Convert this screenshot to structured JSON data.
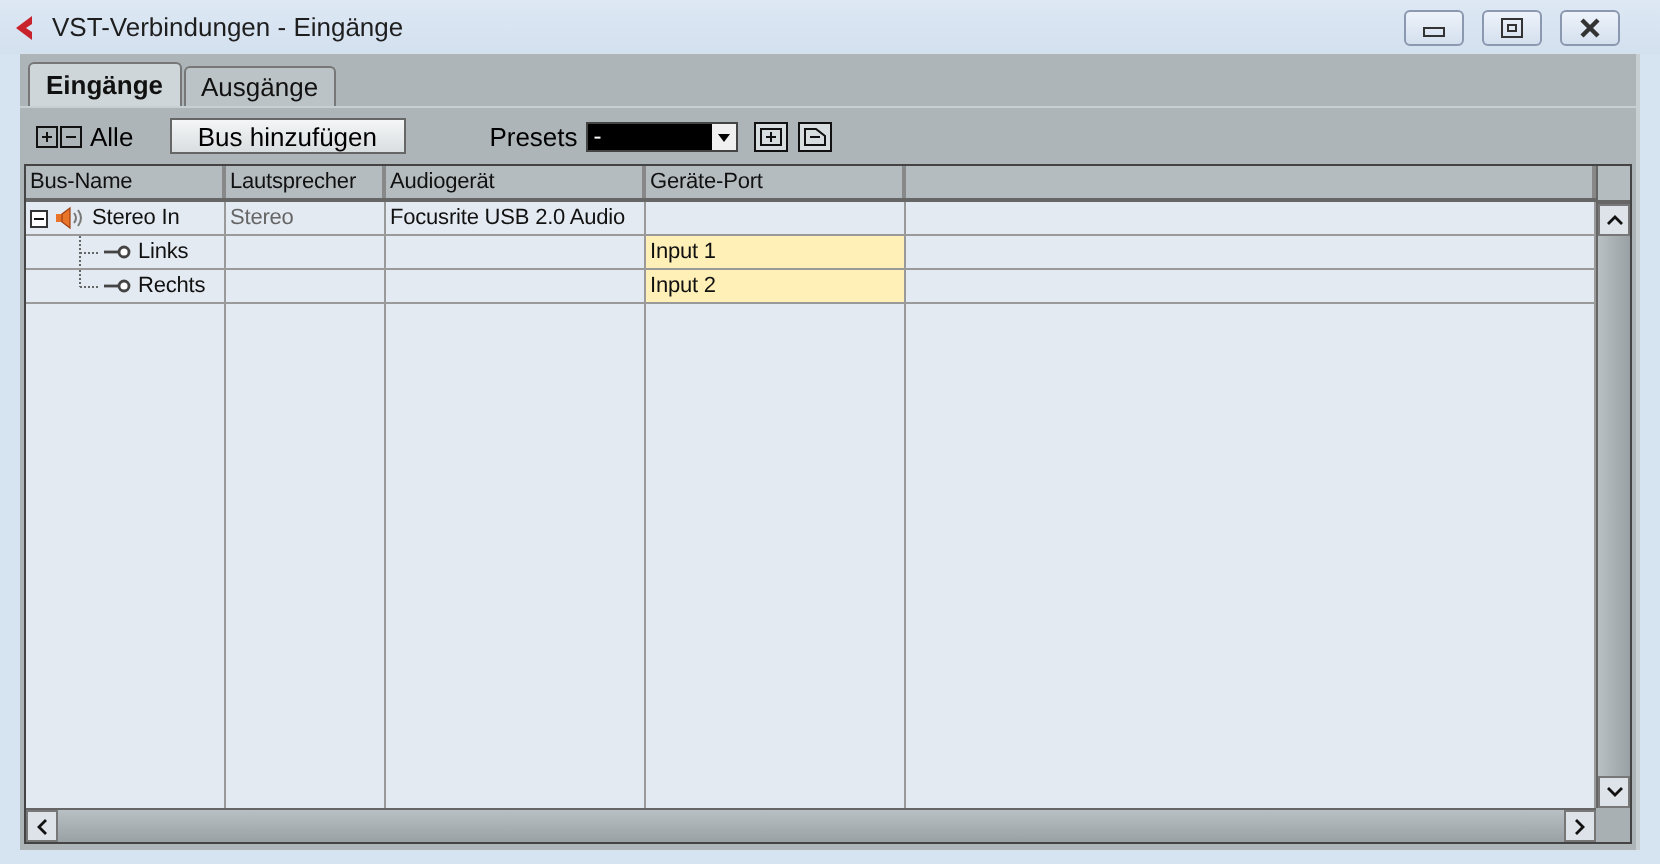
{
  "window": {
    "title": "VST-Verbindungen - Eingänge"
  },
  "tabs": [
    {
      "label": "Eingänge",
      "selected": true
    },
    {
      "label": "Ausgänge",
      "selected": false
    }
  ],
  "toolbar": {
    "all_label": "Alle",
    "add_bus_button": "Bus hinzufügen",
    "presets_label": "Presets",
    "presets_value": "-"
  },
  "table": {
    "columns": [
      "Bus-Name",
      "Lautsprecher",
      "Audiogerät",
      "Geräte-Port"
    ],
    "rows": [
      {
        "name": "Stereo In",
        "speaker": "Stereo",
        "device": "Focusrite USB 2.0 Audio",
        "expanded": true,
        "children": [
          {
            "name": "Links",
            "port": "Input 1"
          },
          {
            "name": "Rechts",
            "port": "Input 2"
          }
        ]
      }
    ]
  }
}
